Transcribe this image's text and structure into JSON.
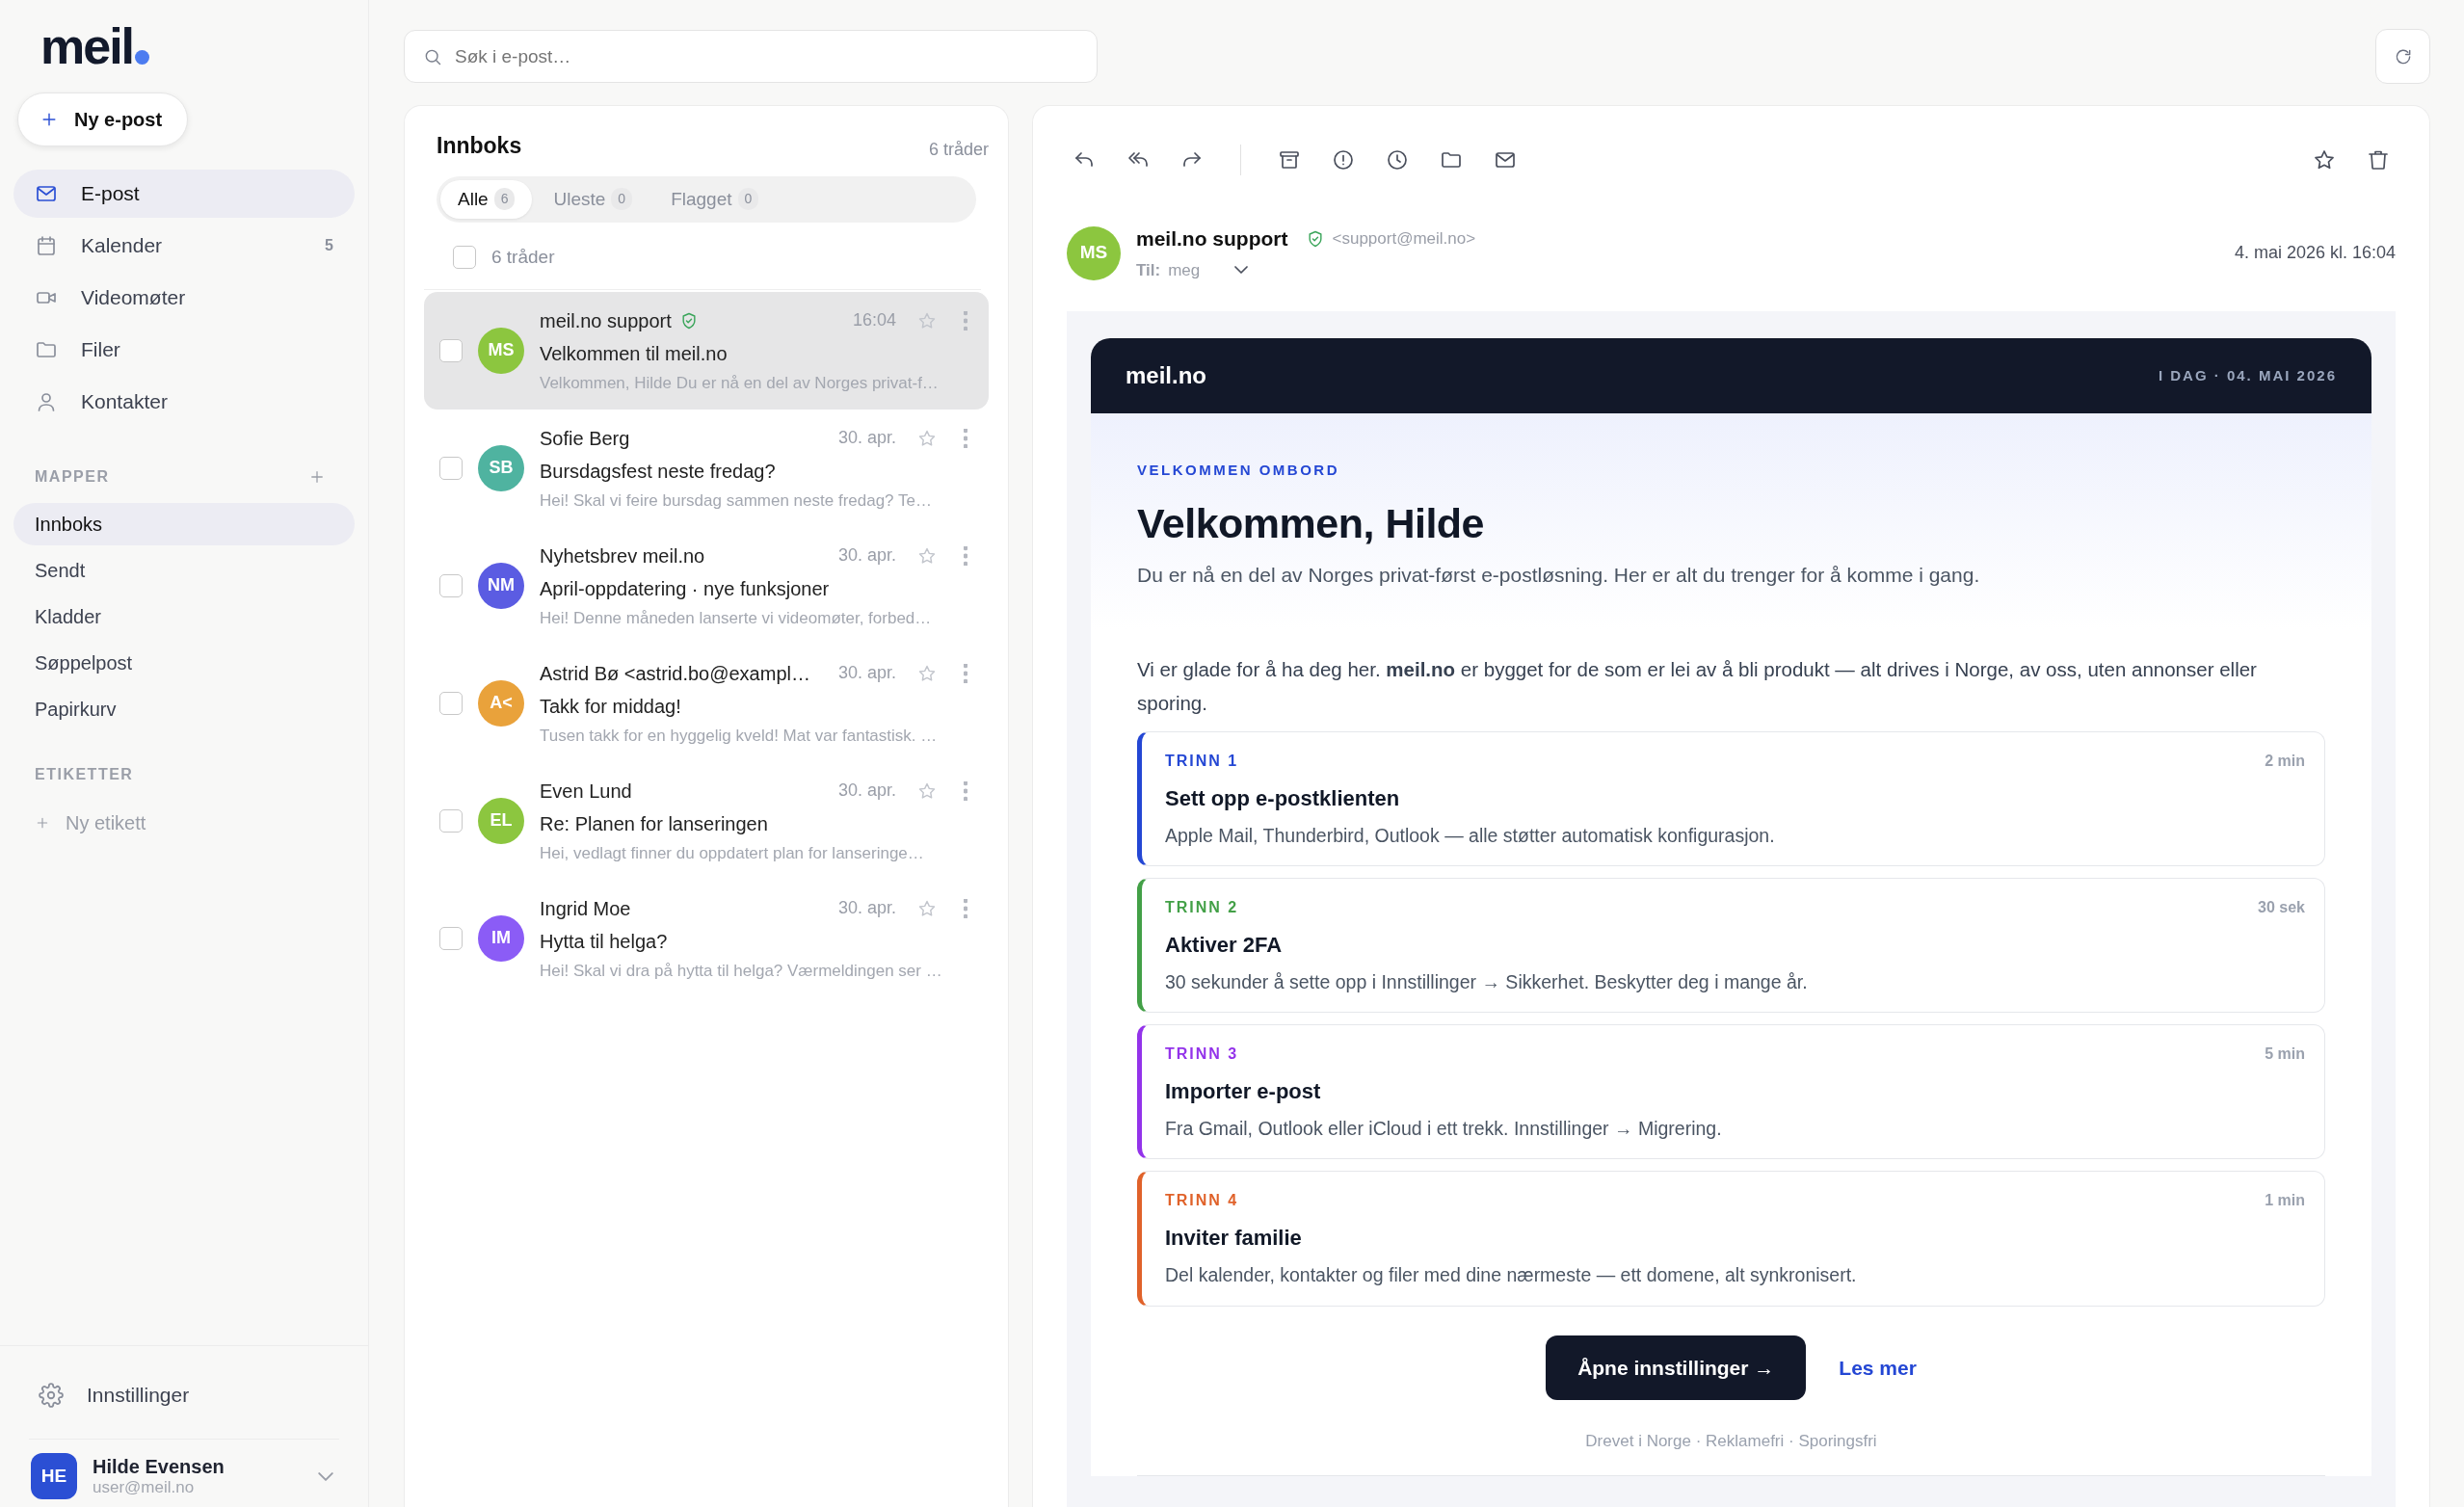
{
  "sidebar": {
    "logo": "meil",
    "compose": "Ny e-post",
    "nav": [
      {
        "label": "E-post",
        "selected": true
      },
      {
        "label": "Kalender",
        "count": "5",
        "selected": false
      },
      {
        "label": "Videomøter",
        "selected": false
      },
      {
        "label": "Filer",
        "selected": false
      },
      {
        "label": "Kontakter",
        "selected": false
      }
    ],
    "folders_heading": "MAPPER",
    "folders": [
      {
        "label": "Innboks",
        "selected": true
      },
      {
        "label": "Sendt",
        "selected": false
      },
      {
        "label": "Kladder",
        "selected": false
      },
      {
        "label": "Søppelpost",
        "selected": false
      },
      {
        "label": "Papirkurv",
        "selected": false
      }
    ],
    "labels_heading": "ETIKETTER",
    "new_label": "Ny etikett",
    "settings": "Innstillinger",
    "user": {
      "initials": "HE",
      "name": "Hilde Evensen",
      "email": "user@meil.no"
    }
  },
  "search": {
    "placeholder": "Søk i e-post…"
  },
  "list": {
    "title": "Innboks",
    "count": "6 tråder",
    "filters": [
      {
        "label": "Alle",
        "count": "6",
        "selected": true
      },
      {
        "label": "Uleste",
        "count": "0",
        "selected": false
      },
      {
        "label": "Flagget",
        "count": "0",
        "selected": false
      }
    ],
    "select_all": {
      "label": "6 tråder",
      "checked": false
    },
    "messages": [
      {
        "initials": "MS",
        "color": "#8cc63f",
        "sender": "meil.no support",
        "verified": true,
        "time": "16:04",
        "subject": "Velkommen til meil.no",
        "preview": "Velkommen, Hilde Du er nå en del av Norges privat-f…",
        "selected": true,
        "checked": false,
        "starred": false
      },
      {
        "initials": "SB",
        "color": "#4fb3a0",
        "sender": "Sofie Berg",
        "verified": false,
        "time": "30. apr.",
        "subject": "Bursdagsfest neste fredag?",
        "preview": "Hei! Skal vi feire bursdag sammen neste fredag? Te…",
        "selected": false,
        "checked": false,
        "starred": false
      },
      {
        "initials": "NM",
        "color": "#5b5ce2",
        "sender": "Nyhetsbrev meil.no",
        "verified": false,
        "time": "30. apr.",
        "subject": "April-oppdatering · nye funksjoner",
        "preview": "Hei! Denne måneden lanserte vi videomøter, forbed…",
        "selected": false,
        "checked": false,
        "starred": false
      },
      {
        "initials": "A<",
        "color": "#e9a23b",
        "sender": "Astrid Bø <astrid.bo@exampl…",
        "verified": false,
        "time": "30. apr.",
        "subject": "Takk for middag!",
        "preview": "Tusen takk for en hyggelig kveld! Mat var fantastisk. …",
        "selected": false,
        "checked": false,
        "starred": false
      },
      {
        "initials": "EL",
        "color": "#8cc63f",
        "sender": "Even Lund",
        "verified": false,
        "time": "30. apr.",
        "subject": "Re: Planen for lanseringen",
        "preview": "Hei, vedlagt finner du oppdatert plan for lanseringe…",
        "selected": false,
        "checked": false,
        "starred": false
      },
      {
        "initials": "IM",
        "color": "#8b5cf6",
        "sender": "Ingrid Moe",
        "verified": false,
        "time": "30. apr.",
        "subject": "Hytta til helga?",
        "preview": "Hei! Skal vi dra på hytta til helga? Værmeldingen ser …",
        "selected": false,
        "checked": false,
        "starred": false
      }
    ]
  },
  "reader": {
    "starred": false,
    "sender": {
      "initials": "MS",
      "color": "#8cc63f",
      "name": "meil.no support",
      "verified": true,
      "address": "<support@meil.no>",
      "to_label": "Til:",
      "to": "meg",
      "date": "4. mai 2026 kl. 16:04"
    },
    "email": {
      "brand": "meil.no",
      "dateline": "I DAG · 04. MAI 2026",
      "eyebrow": "VELKOMMEN OMBORD",
      "heading": "Velkommen, Hilde",
      "lead": "Du er nå en del av Norges privat-først e-postløsning. Her er alt du trenger for å komme i gang.",
      "body": "Vi er glade for å ha deg her. **meil.no** er bygget for de som er lei av å bli produkt — alt drives i Norge, av oss, uten annonser eller sporing.",
      "steps": [
        {
          "label": "TRINN 1",
          "color": "#2447d4",
          "duration": "2 min",
          "title": "Sett opp e-postklienten",
          "text": "Apple Mail, Thunderbird, Outlook — alle støtter automatisk konfigurasjon."
        },
        {
          "label": "TRINN 2",
          "color": "#43a047",
          "duration": "30 sek",
          "title": "Aktiver 2FA",
          "text": "30 sekunder å sette opp i Innstillinger → Sikkerhet. Beskytter deg i mange år."
        },
        {
          "label": "TRINN 3",
          "color": "#9333ea",
          "duration": "5 min",
          "title": "Importer e-post",
          "text": "Fra Gmail, Outlook eller iCloud i ett trekk. Innstillinger → Migrering."
        },
        {
          "label": "TRINN 4",
          "color": "#e0622a",
          "duration": "1 min",
          "title": "Inviter familie",
          "text": "Del kalender, kontakter og filer med dine nærmeste — ett domene, alt synkronisert."
        }
      ],
      "cta": "Åpne innstillinger →",
      "link": "Les mer",
      "footer": "Drevet i Norge · Reklamefri · Sporingsfri"
    }
  }
}
